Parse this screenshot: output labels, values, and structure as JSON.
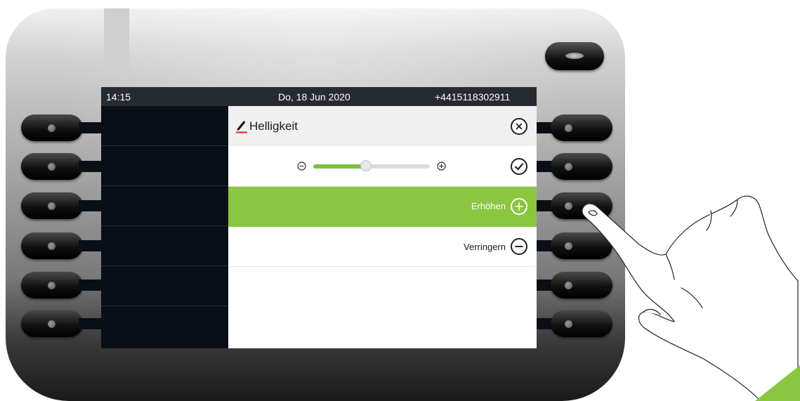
{
  "statusbar": {
    "time": "14:15",
    "date": "Do, 18 Jun 2020",
    "number": "+4415118302911"
  },
  "dialog": {
    "title": "Helligkeit",
    "brightness_level": 0.45,
    "increase_label": "Erhöhen",
    "decrease_label": "Verringern"
  },
  "icons": {
    "title": "pencil-icon",
    "close": "close-circle-icon",
    "confirm": "checkmark-circle-icon",
    "slider_minus": "minus-icon",
    "slider_plus": "plus-icon",
    "increase": "plus-circle-icon",
    "decrease": "minus-circle-icon"
  },
  "colors": {
    "accent": "#8bc640",
    "slider_fill": "#7ac143",
    "statusbar": "#262b31",
    "screen": "#0a0f17"
  }
}
